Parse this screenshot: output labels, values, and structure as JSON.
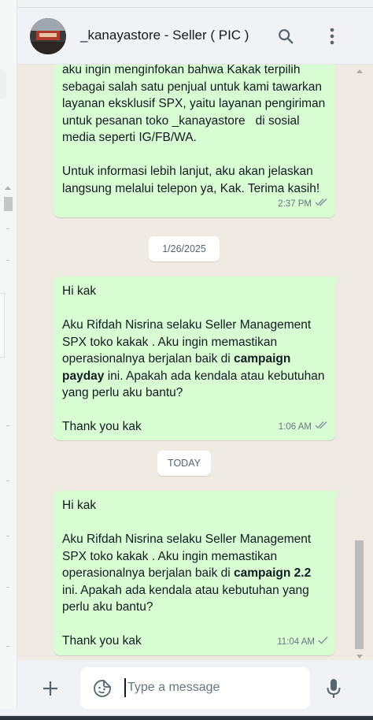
{
  "header": {
    "contact_name": "_kanayastore - Seller ( PIC )",
    "search_icon": "search-icon",
    "menu_icon": "vertical-ellipsis-icon"
  },
  "messages": [
    {
      "lines": [
        "aku ingin menginfokan bahwa Kakak terpilih",
        "sebagai salah satu penjual untuk kami tawarkan",
        "layanan eksklusif SPX, yaitu layanan pengiriman",
        "untuk pesanan toko _kanayastore   di sosial",
        "media seperti IG/FB/WA.",
        "",
        "Untuk informasi lebih lanjut, aku akan jelaskan",
        "langsung melalui telepon ya, Kak. Terima kasih!"
      ],
      "time": "2:37 PM",
      "status": "double-check-icon"
    },
    {
      "date": "1/26/2025",
      "greeting": "Hi kak",
      "line1": "Aku Rifdah Nisrina selaku Seller Management",
      "line2": "SPX toko kakak . Aku ingin memastikan",
      "line3_before": "operasionalnya berjalan baik di ",
      "line3_bold": "campaign",
      "line4_bold": "payday",
      "line4_after": " ini. Apakah ada kendala atau kebutuhan",
      "line5": "yang perlu aku bantu?",
      "closing": "Thank you kak",
      "time": "1:06 AM",
      "status": "double-check-icon"
    },
    {
      "date": "TODAY",
      "greeting": "Hi kak",
      "line1": "Aku Rifdah Nisrina selaku Seller Management",
      "line2": "SPX toko kakak . Aku ingin memastikan",
      "line3_before": "operasionalnya berjalan baik di ",
      "line3_bold": "campaign 2.2",
      "line4": "ini. Apakah ada kendala atau kebutuhan yang",
      "line5": "perlu aku bantu?",
      "closing": "Thank you kak",
      "time": "11:04 AM",
      "status": "single-check-icon"
    }
  ],
  "footer": {
    "input_placeholder": "Type a message",
    "attach_icon": "plus-icon",
    "emoji_icon": "sticker-icon",
    "mic_icon": "microphone-icon"
  },
  "colors": {
    "outgoing_bubble": "#d9fdd3",
    "chat_background": "#efeae2",
    "header_background": "#f0f2f5",
    "meta_text": "#667781"
  }
}
